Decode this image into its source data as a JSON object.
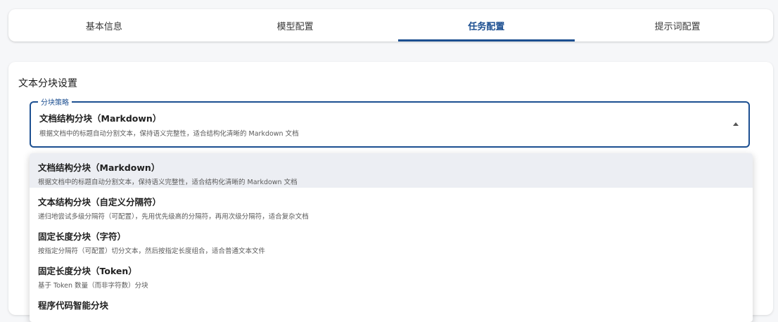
{
  "tabs": [
    {
      "label": "基本信息",
      "active": false
    },
    {
      "label": "模型配置",
      "active": false
    },
    {
      "label": "任务配置",
      "active": true
    },
    {
      "label": "提示词配置",
      "active": false
    }
  ],
  "section": {
    "title": "文本分块设置"
  },
  "select": {
    "legend": "分块策略",
    "value_title": "文档结构分块（Markdown）",
    "value_desc": "根据文档中的标题自动分割文本，保持语义完整性，适合结构化清晰的 Markdown 文档",
    "icon": "arrow-up-icon"
  },
  "options": [
    {
      "title": "文档结构分块（Markdown）",
      "desc": "根据文档中的标题自动分割文本，保持语义完整性，适合结构化清晰的 Markdown 文档",
      "selected": true
    },
    {
      "title": "文本结构分块（自定义分隔符）",
      "desc": "递归地尝试多级分隔符（可配置），先用优先级高的分隔符，再用次级分隔符，适合复杂文档",
      "selected": false
    },
    {
      "title": "固定长度分块（字符）",
      "desc": "按指定分隔符（可配置）切分文本，然后按指定长度组合，适合普通文本文件",
      "selected": false
    },
    {
      "title": "固定长度分块（Token）",
      "desc": "基于 Token 数量（而非字符数）分块",
      "selected": false
    },
    {
      "title": "程序代码智能分块",
      "desc": "",
      "selected": false
    }
  ],
  "colors": {
    "accent": "#1c4f91",
    "selected_bg": "#eceef3"
  }
}
